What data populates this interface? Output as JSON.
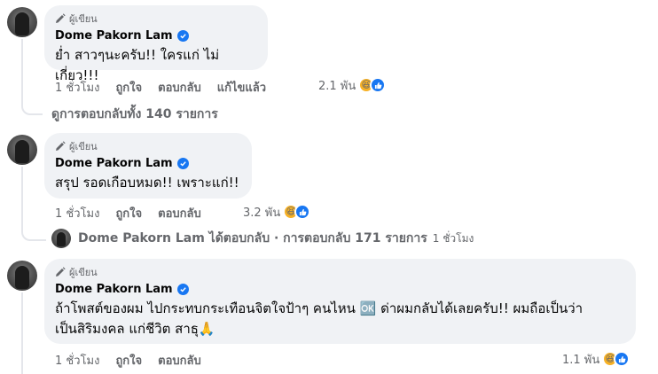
{
  "comments": [
    {
      "author_badge": "ผู้เขียน",
      "name": "Dome Pakorn Lam",
      "text": [
        "ย่ำ สาวๆนะครับ!! ใครแก่ ไม่เกี่ยว!!!"
      ],
      "time": "1 ชั่วโมง",
      "like_label": "ถูกใจ",
      "reply_label": "ตอบกลับ",
      "edited_label": "แก้ไขแล้ว",
      "reaction_count": "2.1 พัน",
      "reactions": [
        "haha-icon",
        "like-icon"
      ]
    },
    {
      "author_badge": "ผู้เขียน",
      "name": "Dome Pakorn Lam",
      "text": [
        "สรุป รอดเกือบหมด!! เพราะแก่!!"
      ],
      "time": "1 ชั่วโมง",
      "like_label": "ถูกใจ",
      "reply_label": "ตอบกลับ",
      "reaction_count": "3.2 พัน",
      "reactions": [
        "haha-icon",
        "like-icon"
      ]
    },
    {
      "author_badge": "ผู้เขียน",
      "name": "Dome Pakorn Lam",
      "text": [
        "ถ้าโพสต์ของผม ไปกระทบกระเทือนจิตใจป้าๆ คนไหน 🆗 ด่าผมกลับได้เลยครับ!! ผมถือเป็นว่า",
        "เป็นสิริมงคล แก่ชีวิต สาธุ🙏"
      ],
      "time": "1 ชั่วโมง",
      "like_label": "ถูกใจ",
      "reply_label": "ตอบกลับ",
      "reaction_count": "1.1 พัน",
      "reactions": [
        "haha-icon",
        "like-icon"
      ]
    }
  ],
  "view_replies": "ดูการตอบกลับทั้ง 140 รายการ",
  "reply_summary": {
    "text": "Dome Pakorn Lam ได้ตอบกลับ · การตอบกลับ 171 รายการ",
    "time": "1 ชั่วโมง"
  },
  "colors": {
    "bubble": "#f0f2f5",
    "secondary_text": "#65676b",
    "verified_blue": "#1877f2",
    "haha_yellow": "#f7b125"
  }
}
